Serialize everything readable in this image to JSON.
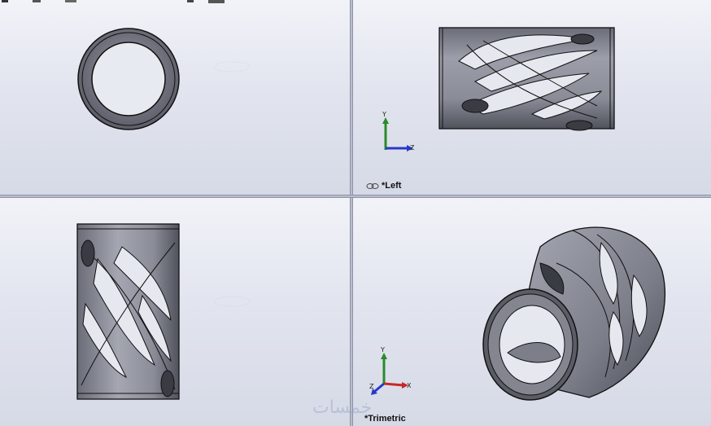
{
  "views": {
    "top_right": {
      "label": "*Left",
      "triad": {
        "up": "Y",
        "right": "Z"
      }
    },
    "bottom_right": {
      "label": "*Trimetric",
      "triad": {
        "up": "Y",
        "right": "X",
        "out": "Z"
      }
    }
  },
  "watermark": "خمسات",
  "colors": {
    "part_fill": "#8a8c98",
    "part_dark": "#4c4e58",
    "edge": "#111111",
    "axis_y": "#2a8a2a",
    "axis_x": "#c82828",
    "axis_z": "#2838c8"
  },
  "icons": {
    "link": "link-icon",
    "triad": "axis-triad-icon"
  }
}
